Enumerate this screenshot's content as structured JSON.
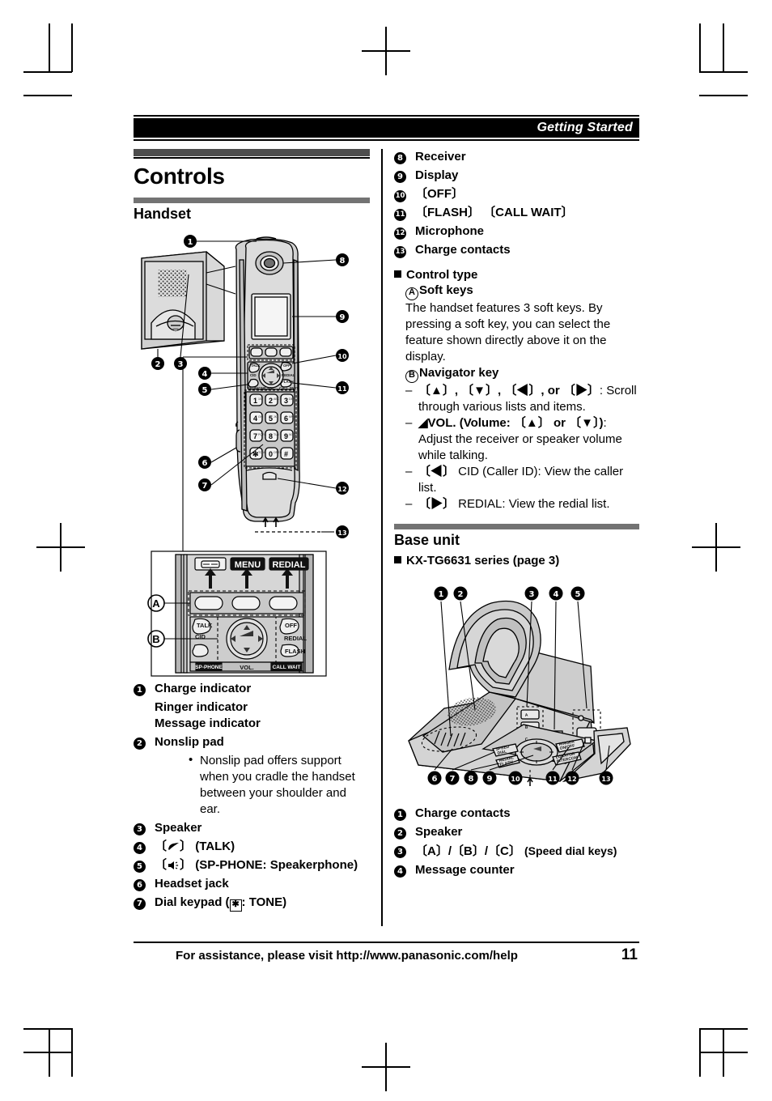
{
  "running_head": {
    "title": "Getting Started"
  },
  "page": {
    "number": "11",
    "footer_text": "For assistance, please visit http://www.panasonic.com/help"
  },
  "left_column": {
    "section_title": "Controls",
    "subsection_title": "Handset",
    "items": [
      {
        "num": "1",
        "label": "Charge indicator",
        "extra_lines": [
          "Ringer indicator",
          "Message indicator"
        ]
      },
      {
        "num": "2",
        "label": "Nonslip pad",
        "bullets": [
          "Nonslip pad offers support when you cradle the handset between your shoulder and ear."
        ]
      },
      {
        "num": "3",
        "label": "Speaker"
      },
      {
        "num": "4",
        "label": "〔↖〕 (TALK)",
        "icon": "talk-handset-icon"
      },
      {
        "num": "5",
        "label": "〔ὐA〕 (SP-PHONE: Speakerphone)",
        "icon": "speakerphone-icon"
      },
      {
        "num": "6",
        "label": "Headset jack"
      },
      {
        "num": "7",
        "label": "Dial keypad (✱: TONE)",
        "icon": "star-key-icon"
      }
    ]
  },
  "right_column": {
    "items": [
      {
        "num": "8",
        "label": "Receiver"
      },
      {
        "num": "9",
        "label": "Display"
      },
      {
        "num": "10",
        "label": "〔OFF〕"
      },
      {
        "num": "11",
        "label": "〔FLASH〕 〔CALL WAIT〕"
      },
      {
        "num": "12",
        "label": "Microphone"
      },
      {
        "num": "13",
        "label": "Charge contacts"
      }
    ],
    "control_type": {
      "heading": "Control type",
      "soft_keys": {
        "letter": "A",
        "title": "Soft keys",
        "body": "The handset features 3 soft keys. By pressing a soft key, you can select the feature shown directly above it on the display."
      },
      "navigator_key": {
        "letter": "B",
        "title": "Navigator key",
        "entries": [
          {
            "keys": "〔▲〕, 〔▼〕, 〔◀〕, or 〔▶〕",
            "text": ": Scroll through various lists and items."
          },
          {
            "keys": "◢VOL. (Volume: 〔▲〕 or 〔▼〕)",
            "text": ": Adjust the receiver or speaker volume while talking."
          },
          {
            "keys": "〔◀〕",
            "text": " CID (Caller ID): View the caller list."
          },
          {
            "keys": "〔▶〕",
            "text": " REDIAL: View the redial list."
          }
        ]
      }
    },
    "base_unit": {
      "subsection_title": "Base unit",
      "model_heading": "KX-TG6631 series (page 3)",
      "items": [
        {
          "num": "1",
          "label": "Charge contacts"
        },
        {
          "num": "2",
          "label": "Speaker"
        },
        {
          "num": "3",
          "label": "〔A〕/〔B〕/〔C〕",
          "suffix": "(Speed dial keys)"
        },
        {
          "num": "4",
          "label": "Message counter"
        }
      ]
    }
  },
  "handset_figure": {
    "callouts": [
      "1",
      "2",
      "3",
      "4",
      "5",
      "6",
      "7",
      "8",
      "9",
      "10",
      "11",
      "12",
      "13"
    ],
    "keypad_keys": [
      {
        "digit": "1",
        "letters": ""
      },
      {
        "digit": "2",
        "letters": "ABC"
      },
      {
        "digit": "3",
        "letters": "DEF"
      },
      {
        "digit": "4",
        "letters": "GHI"
      },
      {
        "digit": "5",
        "letters": "JKL"
      },
      {
        "digit": "6",
        "letters": "MNO"
      },
      {
        "digit": "7",
        "letters": "PQRS"
      },
      {
        "digit": "8",
        "letters": "TUV"
      },
      {
        "digit": "9",
        "letters": "WXYZ"
      },
      {
        "digit": "∗",
        "letters": "TONE"
      },
      {
        "digit": "0",
        "letters": "OPER"
      },
      {
        "digit": "#",
        "letters": ""
      }
    ],
    "key_labels": [
      "TALK",
      "CID",
      "OFF",
      "REDIAL",
      "FLASH",
      "SP-PHONE",
      "VOL.",
      "CALL WAIT"
    ]
  },
  "keypad_detail_figure": {
    "soft_key_labels": [
      "▭",
      "MENU",
      "REDIAL"
    ],
    "letters": [
      "A",
      "B"
    ],
    "side_labels": [
      "TALK",
      "CID",
      "OFF",
      "REDIAL",
      "FLASH",
      "SP-PHONE",
      "VOL.",
      "CALL WAIT"
    ]
  },
  "base_unit_figure": {
    "top_callouts": [
      "1",
      "2",
      "3",
      "4",
      "5"
    ],
    "bottom_callouts": [
      "6",
      "7",
      "8",
      "9",
      "10",
      "11",
      "12",
      "13"
    ],
    "speed_dial_labels": [
      "A",
      "B",
      "C"
    ],
    "key_labels": [
      "SPEED\\nDIAL",
      "MUTE",
      "REDIAL\\nFLASH",
      "RINGER\\nON/OFF",
      "LOCATOR\\nINTERCOM"
    ]
  },
  "colors": {
    "bar_dark": "#4d4d4d",
    "bar_mid": "#737373",
    "ink": "#000000",
    "fill_light": "#d9d9d9",
    "fill_mid": "#bfbfbf"
  }
}
